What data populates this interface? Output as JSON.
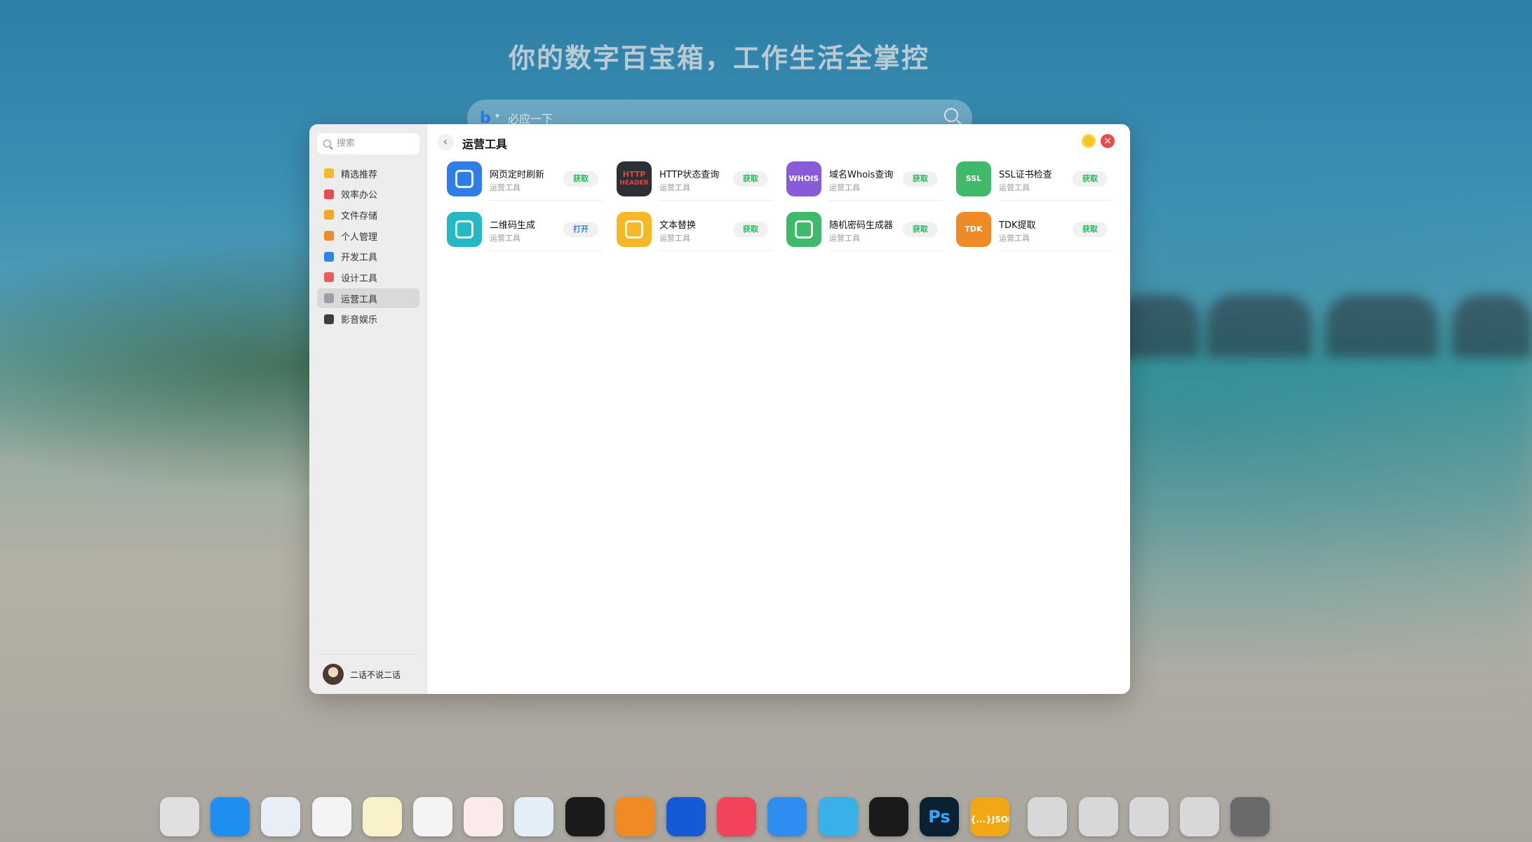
{
  "desktop": {
    "headline": "你的数字百宝箱，工作生活全掌控",
    "search_placeholder": "必应一下"
  },
  "window": {
    "search_placeholder": "搜索",
    "nav": [
      {
        "label": "精选推荐",
        "icon": "star-icon",
        "color": "#f5b922",
        "active": false
      },
      {
        "label": "效率办公",
        "icon": "rocket-icon",
        "color": "#e84d4d",
        "active": false
      },
      {
        "label": "文件存储",
        "icon": "folder-icon",
        "color": "#f5a623",
        "active": false
      },
      {
        "label": "个人管理",
        "icon": "person-icon",
        "color": "#f08a24",
        "active": false
      },
      {
        "label": "开发工具",
        "icon": "devtools-icon",
        "color": "#2b86e4",
        "active": false
      },
      {
        "label": "设计工具",
        "icon": "palette-icon",
        "color": "#e85c5c",
        "active": false
      },
      {
        "label": "运营工具",
        "icon": "document-icon",
        "color": "#9aa0a6",
        "active": true
      },
      {
        "label": "影音娱乐",
        "icon": "clapperboard-icon",
        "color": "#3a3f44",
        "active": false
      }
    ],
    "user": {
      "name": "二话不说二话"
    },
    "title": "运营工具",
    "apps": [
      {
        "name": "网页定时刷新",
        "category": "运营工具",
        "action": "获取",
        "icon": "refresh-page-icon",
        "color": "#2f7de8"
      },
      {
        "name": "HTTP状态查询",
        "category": "运营工具",
        "action": "获取",
        "icon": "http-header-icon",
        "color": "#2c2f36",
        "icon_text_1": "HTTP",
        "icon_text_2": "HEADER"
      },
      {
        "name": "域名Whois查询",
        "category": "运营工具",
        "action": "获取",
        "icon": "whois-globe-icon",
        "color": "#8a5bd8",
        "icon_text_1": "WHOIS"
      },
      {
        "name": "SSL证书检查",
        "category": "运营工具",
        "action": "获取",
        "icon": "ssl-shield-icon",
        "color": "#3fb96a",
        "icon_text_1": "SSL"
      },
      {
        "name": "二维码生成",
        "category": "运营工具",
        "action": "打开",
        "icon": "qrcode-icon",
        "color": "#25b9c4"
      },
      {
        "name": "文本替换",
        "category": "运营工具",
        "action": "获取",
        "icon": "text-replace-icon",
        "color": "#f6b826"
      },
      {
        "name": "随机密码生成器",
        "category": "运营工具",
        "action": "获取",
        "icon": "password-lock-icon",
        "color": "#3fb96a"
      },
      {
        "name": "TDK提取",
        "category": "运营工具",
        "action": "获取",
        "icon": "tdk-extract-icon",
        "color": "#f08a24",
        "icon_text_1": "TDK"
      }
    ]
  },
  "dock": [
    {
      "name": "launchpad-icon",
      "color": "#e0e0e0"
    },
    {
      "name": "app-store-icon",
      "color": "#1e8ef0"
    },
    {
      "name": "icloud-icon",
      "color": "#e8eef5"
    },
    {
      "name": "photos-icon",
      "color": "#f4f4f4"
    },
    {
      "name": "notes-icon",
      "color": "#f9f1c8"
    },
    {
      "name": "reminders-icon",
      "color": "#f4f4f4"
    },
    {
      "name": "calendar-icon",
      "color": "#fbeaea"
    },
    {
      "name": "keychain-icon",
      "color": "#e4eef6"
    },
    {
      "name": "wallet-icon",
      "color": "#1a1a1a"
    },
    {
      "name": "alarm-clock-icon",
      "color": "#f08a24"
    },
    {
      "name": "video-player-icon",
      "color": "#1659d6"
    },
    {
      "name": "music-icon",
      "color": "#f2435a"
    },
    {
      "name": "safari-icon",
      "color": "#2e8ef0"
    },
    {
      "name": "pencil-icon",
      "color": "#39b0e8"
    },
    {
      "name": "diff-merge-icon",
      "color": "#1a1a1a"
    },
    {
      "name": "photoshop-icon",
      "color": "#0c2034",
      "text": "Ps"
    },
    {
      "name": "json-editor-icon",
      "color": "#f1a814",
      "text": "{...}JSON"
    },
    {
      "name": "add-icon",
      "color": "#d8d8d8"
    },
    {
      "name": "extensions-icon",
      "color": "#d8d8d8"
    },
    {
      "name": "brush-icon",
      "color": "#d8d8d8"
    },
    {
      "name": "lock-settings-icon",
      "color": "#d8d8d8"
    },
    {
      "name": "system-settings-icon",
      "color": "#6a6a6a"
    }
  ]
}
